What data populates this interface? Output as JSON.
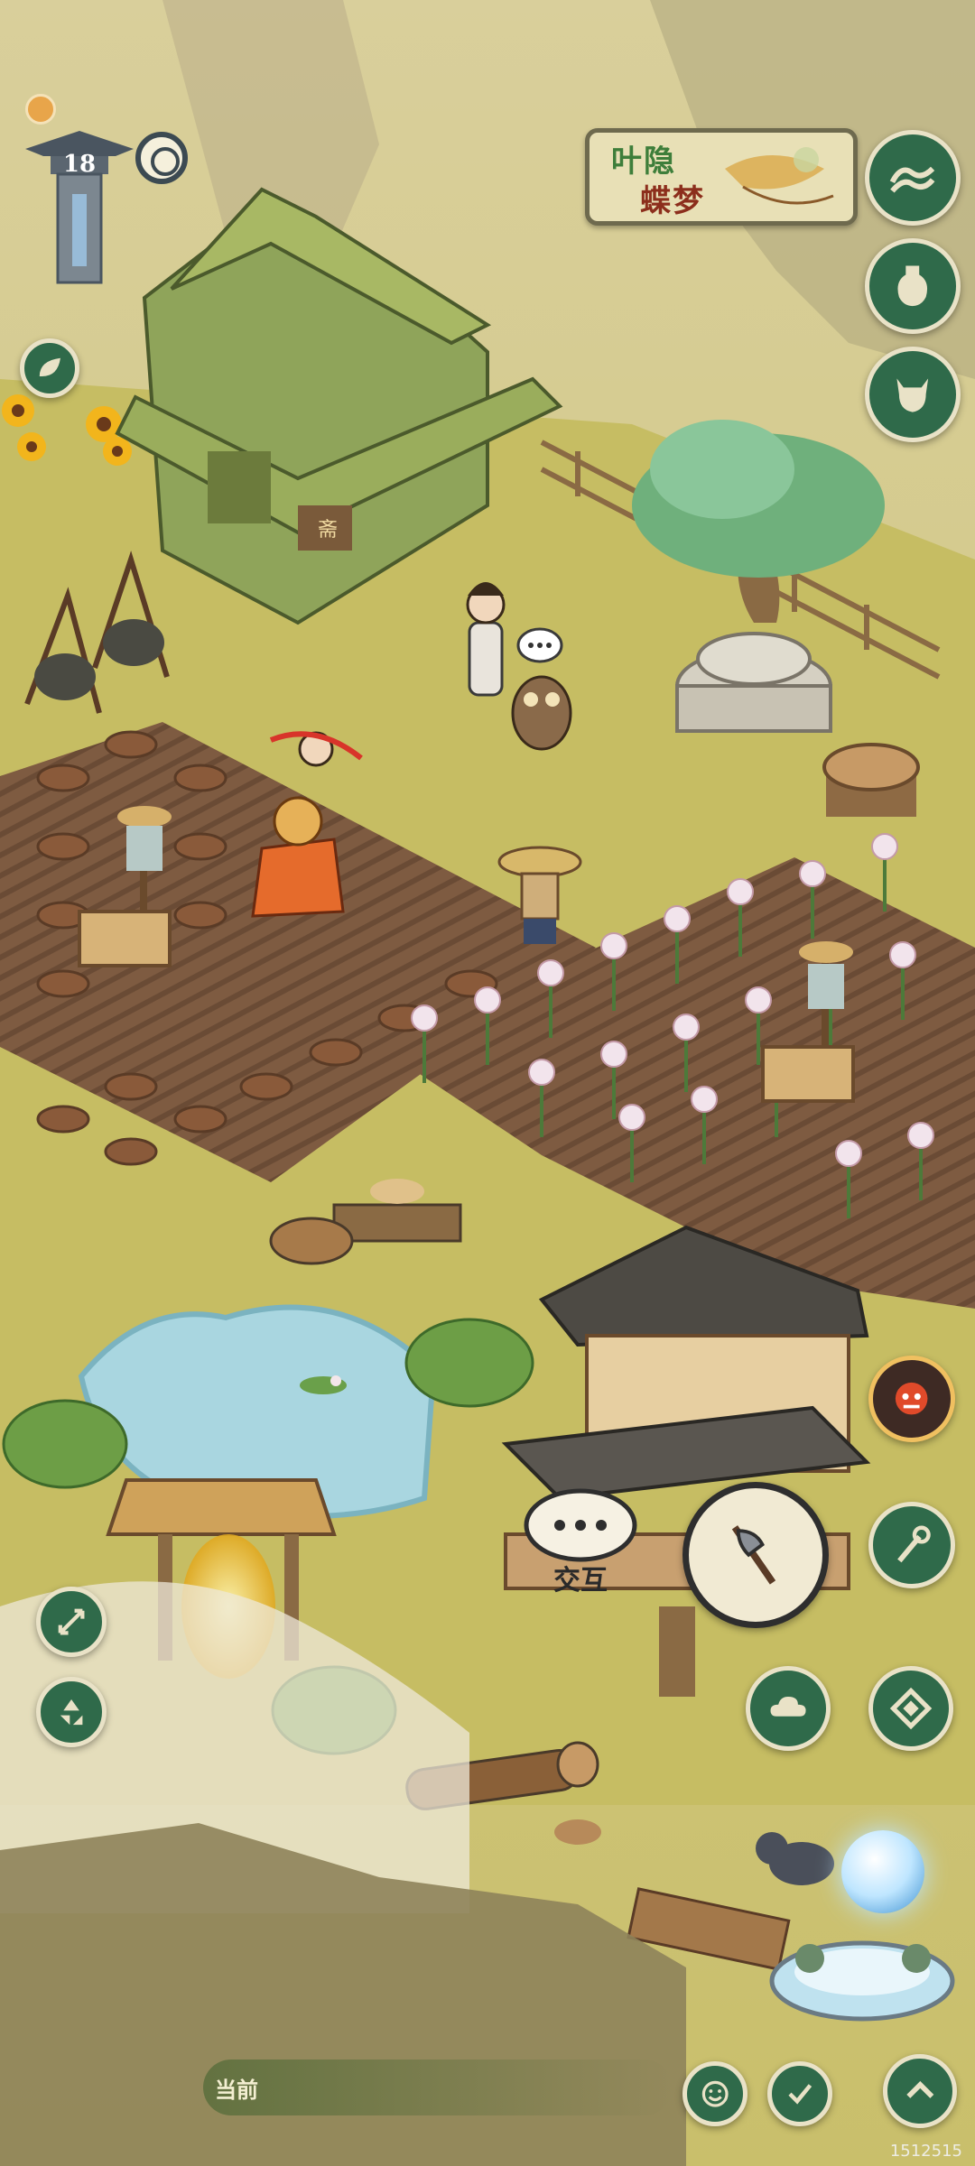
{
  "hud": {
    "level": "18"
  },
  "event_banner": {
    "line1": "叶隐",
    "line2": "蝶梦"
  },
  "interact": {
    "label": "交互"
  },
  "bottom": {
    "current_label": "当前"
  },
  "watermark": "1512515",
  "colors": {
    "button_fill": "#2f6a4a",
    "button_border": "#e9e2c7",
    "grass": "#c6bd63",
    "soil": "#7a5a40"
  },
  "icons": [
    "wave-icon",
    "potion-icon",
    "creature-icon",
    "leaf-icon",
    "expand-icon",
    "recycle-icon",
    "axe-icon",
    "monster-face-icon",
    "staff-icon",
    "cloud-icon",
    "diamond-icon",
    "smile-icon",
    "check-icon",
    "chevron-up-icon",
    "orb-icon"
  ]
}
